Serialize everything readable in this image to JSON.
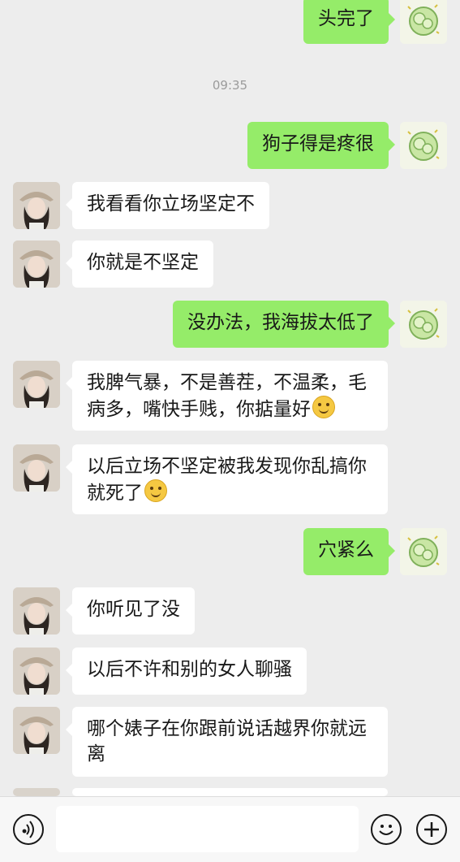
{
  "timestamp": "09:35",
  "messages": [
    {
      "side": "right",
      "text": "头完了"
    },
    {
      "side": "right",
      "text": "狗子得是疼很"
    },
    {
      "side": "left",
      "text": "我看看你立场坚定不"
    },
    {
      "side": "left",
      "text": "你就是不坚定"
    },
    {
      "side": "right",
      "text": "没办法，我海拔太低了"
    },
    {
      "side": "left",
      "text": "我脾气暴，不是善茬，不温柔，毛病多，嘴快手贱，你掂量好",
      "emoji": "smile-emoji"
    },
    {
      "side": "left",
      "text": "以后立场不坚定被我发现你乱搞你就死了",
      "emoji": "smile-emoji"
    },
    {
      "side": "right",
      "text": "穴紧么"
    },
    {
      "side": "left",
      "text": "你听见了没"
    },
    {
      "side": "left",
      "text": "以后不许和别的女人聊骚"
    },
    {
      "side": "left",
      "text": "哪个婊子在你跟前说话越界你就远离"
    }
  ],
  "input_bar": {
    "voice_icon": "voice-icon",
    "emoji_icon": "emoji-icon",
    "add_icon": "add-icon",
    "field_value": ""
  },
  "colors": {
    "self_bubble": "#95ec69",
    "other_bubble": "#ffffff",
    "background": "#ededed"
  }
}
